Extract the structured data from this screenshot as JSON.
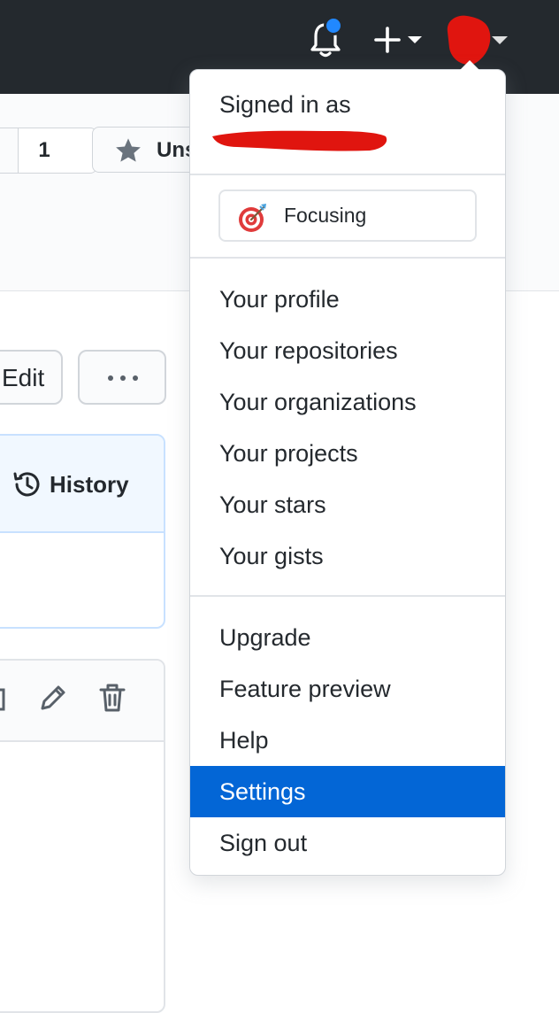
{
  "repo": {
    "star_count": "1",
    "unstar_label": "Unstar",
    "edit_label": "Edit file",
    "more_label": "…",
    "history_label": "History"
  },
  "dropdown": {
    "signed_in_label": "Signed in as",
    "username": "",
    "status": {
      "emoji_icon": "direct-hit-target-icon",
      "label": "Focusing"
    },
    "section1": [
      "Your profile",
      "Your repositories",
      "Your organizations",
      "Your projects",
      "Your stars",
      "Your gists"
    ],
    "section2": [
      "Upgrade",
      "Feature preview",
      "Help",
      "Settings",
      "Sign out"
    ],
    "active_item": "Settings"
  },
  "colors": {
    "header_bg": "#24292e",
    "accent": "#0366d6",
    "notification_dot": "#2188ff",
    "redaction": "#e0150f"
  }
}
